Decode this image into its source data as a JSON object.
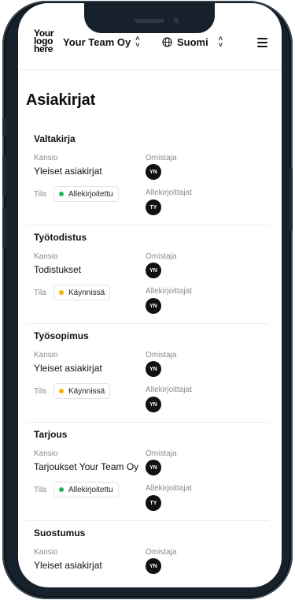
{
  "header": {
    "logo_line1": "Your",
    "logo_line2": "logo",
    "logo_line3": "here",
    "team": "Your Team Oy",
    "language": "Suomi"
  },
  "page_title": "Asiakirjat",
  "labels": {
    "folder": "Kansio",
    "owner": "Omistaja",
    "status": "Tila",
    "signers": "Allekirjoittajat"
  },
  "colors": {
    "signed": "#1db954",
    "in_progress": "#f0b400"
  },
  "documents": [
    {
      "title": "Valtakirja",
      "folder": "Yleiset asiakirjat",
      "owner": "YN",
      "status": "Allekirjoitettu",
      "status_type": "signed",
      "signer": "TY"
    },
    {
      "title": "Työtodistus",
      "folder": "Todistukset",
      "owner": "YN",
      "status": "Käynnissä",
      "status_type": "in_progress",
      "signer": "YN"
    },
    {
      "title": "Työsopimus",
      "folder": "Yleiset asiakirjat",
      "owner": "YN",
      "status": "Käynnissä",
      "status_type": "in_progress",
      "signer": "YN"
    },
    {
      "title": "Tarjous",
      "folder": "Tarjoukset Your Team Oy",
      "owner": "YN",
      "status": "Allekirjoitettu",
      "status_type": "signed",
      "signer": "TY"
    },
    {
      "title": "Suostumus",
      "folder": "Yleiset asiakirjat",
      "owner": "YN",
      "status": "",
      "status_type": "",
      "signer": ""
    }
  ]
}
